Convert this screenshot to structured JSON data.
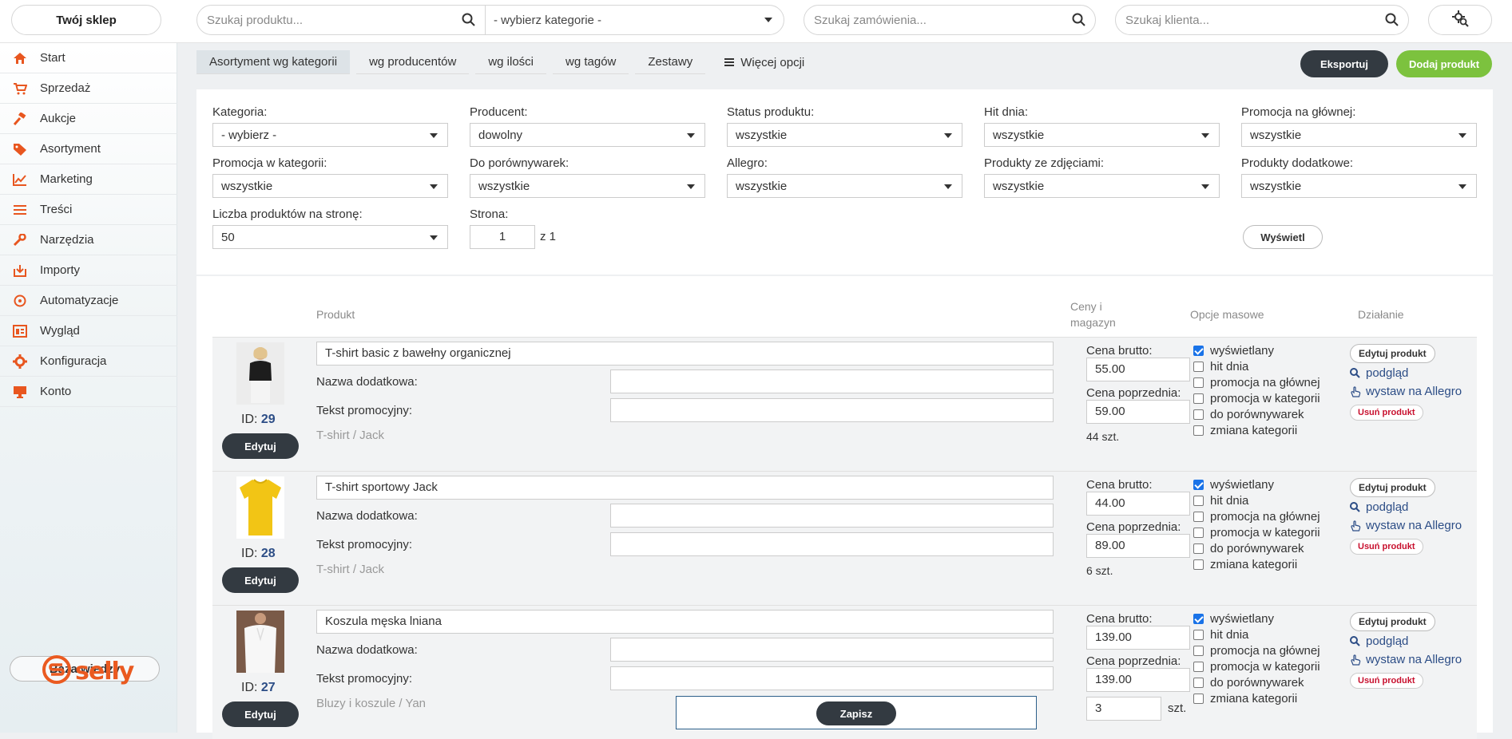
{
  "topbar": {
    "shop_button": "Twój sklep",
    "product_search_placeholder": "Szukaj produktu...",
    "category_select": "- wybierz kategorie -",
    "order_search_placeholder": "Szukaj zamówienia...",
    "client_search_placeholder": "Szukaj klienta..."
  },
  "sidebar": {
    "items": [
      {
        "label": "Start",
        "icon": "home-icon"
      },
      {
        "label": "Sprzedaż",
        "icon": "cart-icon"
      },
      {
        "label": "Aukcje",
        "icon": "gavel-icon"
      },
      {
        "label": "Asortyment",
        "icon": "tag-icon"
      },
      {
        "label": "Marketing",
        "icon": "chart-icon"
      },
      {
        "label": "Treści",
        "icon": "lines-icon"
      },
      {
        "label": "Narzędzia",
        "icon": "wrench-icon"
      },
      {
        "label": "Importy",
        "icon": "import-icon"
      },
      {
        "label": "Automatyzacje",
        "icon": "automation-icon"
      },
      {
        "label": "Wygląd",
        "icon": "layout-icon"
      },
      {
        "label": "Konfiguracja",
        "icon": "gear-icon"
      },
      {
        "label": "Konto",
        "icon": "monitor-icon"
      }
    ],
    "knowledge_base": "Baza wiedzy",
    "logo_text": "selly"
  },
  "tabs": [
    "Asortyment wg kategorii",
    "wg producentów",
    "wg ilości",
    "wg tagów",
    "Zestawy",
    "Więcej opcji"
  ],
  "actions": {
    "export": "Eksportuj",
    "add_product": "Dodaj produkt"
  },
  "filters": {
    "category": {
      "label": "Kategoria:",
      "value": "- wybierz -"
    },
    "producer": {
      "label": "Producent:",
      "value": "dowolny"
    },
    "status": {
      "label": "Status produktu:",
      "value": "wszystkie"
    },
    "hit": {
      "label": "Hit dnia:",
      "value": "wszystkie"
    },
    "promo_main": {
      "label": "Promocja na głównej:",
      "value": "wszystkie"
    },
    "promo_cat": {
      "label": "Promocja w kategorii:",
      "value": "wszystkie"
    },
    "comparers": {
      "label": "Do porównywarek:",
      "value": "wszystkie"
    },
    "allegro": {
      "label": "Allegro:",
      "value": "wszystkie"
    },
    "with_photos": {
      "label": "Produkty ze zdjęciami:",
      "value": "wszystkie"
    },
    "extra": {
      "label": "Produkty dodatkowe:",
      "value": "wszystkie"
    },
    "per_page": {
      "label": "Liczba produktów na stronę:",
      "value": "50"
    },
    "page": {
      "label": "Strona:",
      "value": "1",
      "of": "z 1"
    },
    "show_button": "Wyświetl"
  },
  "table": {
    "headers": {
      "product": "Produkt",
      "prices": "Ceny i",
      "prices2": "magazyn",
      "bulk": "Opcje masowe",
      "action": "Działanie"
    },
    "labels": {
      "extra_name": "Nazwa dodatkowa:",
      "promo_text": "Tekst promocyjny:",
      "price_gross": "Cena brutto:",
      "price_prev": "Cena poprzednia:",
      "edit": "Edytuj",
      "id_prefix": "ID:",
      "edit_product": "Edytuj produkt",
      "preview": "podgląd",
      "allegro": "wystaw na Allegro",
      "delete": "Usuń produkt",
      "opt_visible": "wyświetlany",
      "opt_hit": "hit dnia",
      "opt_promo_main": "promocja na głównej",
      "opt_promo_cat": "promocja w kategorii",
      "opt_compare": "do porównywarek",
      "opt_change_cat": "zmiana kategorii",
      "pcs": "szt."
    },
    "rows": [
      {
        "id": "29",
        "name": "T-shirt basic z bawełny organicznej",
        "category": "T-shirt / Jack",
        "price": "55.00",
        "prev": "59.00",
        "stock": "44 szt."
      },
      {
        "id": "28",
        "name": "T-shirt sportowy Jack",
        "category": "T-shirt / Jack",
        "price": "44.00",
        "prev": "89.00",
        "stock": "6 szt."
      },
      {
        "id": "27",
        "name": "Koszula męska lniana",
        "category": "Bluzy i koszule / Yan",
        "price": "139.00",
        "prev": "139.00",
        "stock": "3"
      }
    ]
  },
  "save_button": "Zapisz"
}
